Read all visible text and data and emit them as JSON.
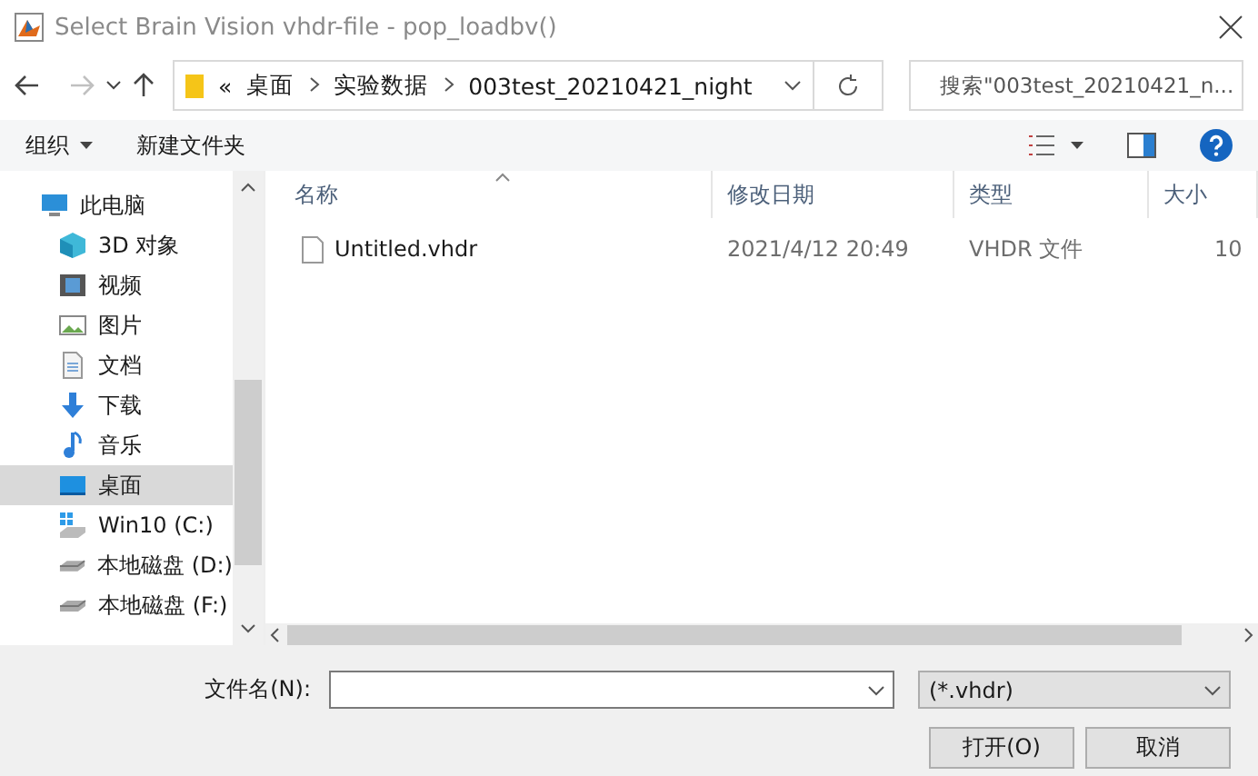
{
  "window": {
    "title": "Select Brain Vision vhdr-file - pop_loadbv()"
  },
  "address": {
    "overflow": "«",
    "crumbs": [
      "桌面",
      "实验数据",
      "003test_20210421_night"
    ]
  },
  "search": {
    "placeholder": "搜索\"003test_20210421_n..."
  },
  "toolbar": {
    "organize": "组织",
    "new_folder": "新建文件夹"
  },
  "sidebar": {
    "items": [
      {
        "label": "此电脑",
        "kind": "pc",
        "selected": false
      },
      {
        "label": "3D 对象",
        "kind": "cube",
        "selected": false
      },
      {
        "label": "视频",
        "kind": "video",
        "selected": false
      },
      {
        "label": "图片",
        "kind": "picture",
        "selected": false
      },
      {
        "label": "文档",
        "kind": "document",
        "selected": false
      },
      {
        "label": "下载",
        "kind": "download",
        "selected": false
      },
      {
        "label": "音乐",
        "kind": "music",
        "selected": false
      },
      {
        "label": "桌面",
        "kind": "desktop",
        "selected": true
      },
      {
        "label": "Win10 (C:)",
        "kind": "system-drive",
        "selected": false
      },
      {
        "label": "本地磁盘 (D:)",
        "kind": "drive",
        "selected": false
      },
      {
        "label": "本地磁盘 (F:)",
        "kind": "drive",
        "selected": false
      }
    ]
  },
  "table": {
    "columns": [
      "名称",
      "修改日期",
      "类型",
      "大小"
    ],
    "rows": [
      {
        "name": "Untitled.vhdr",
        "date": "2021/4/12 20:49",
        "type": "VHDR 文件",
        "size": "10"
      }
    ]
  },
  "footer": {
    "filename_label": "文件名(N):",
    "filter": "(*.vhdr)",
    "buttons": [
      "打开(O)",
      "取消"
    ]
  }
}
